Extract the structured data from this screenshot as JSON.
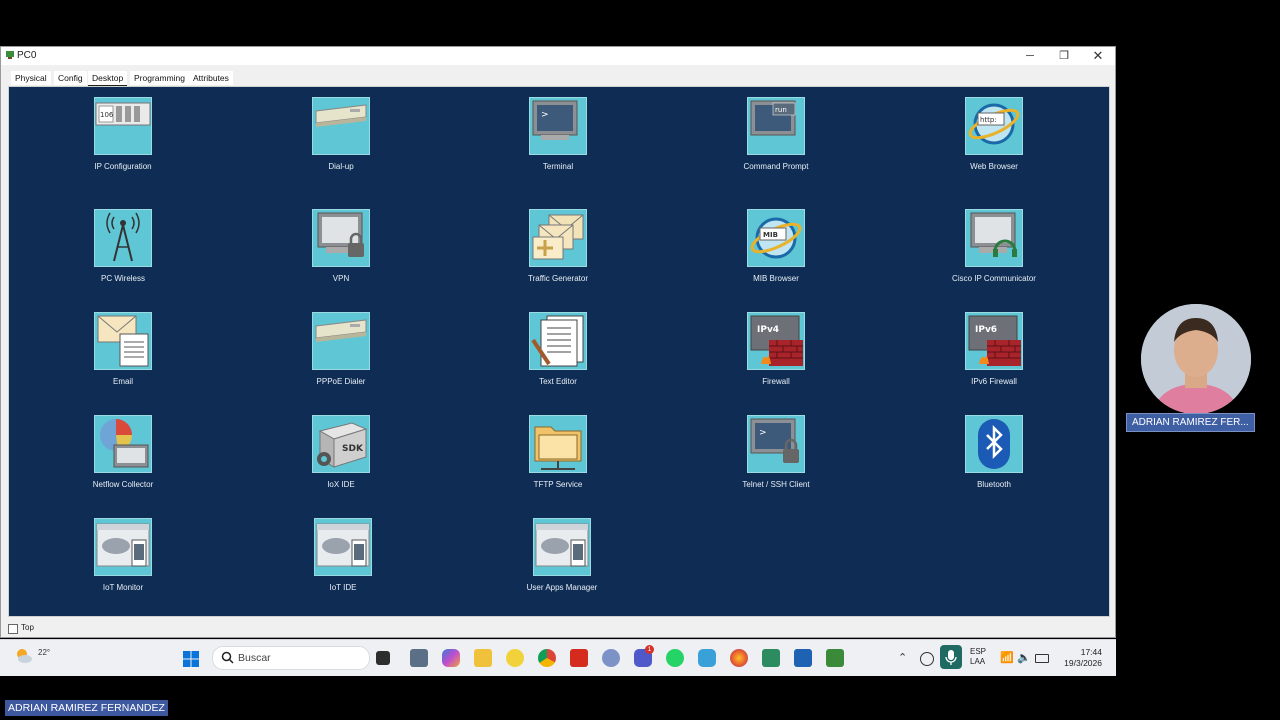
{
  "window": {
    "title": "PC0",
    "controls": {
      "minimize": "─",
      "maximize": "❐",
      "close": "✕"
    }
  },
  "tabs": [
    {
      "label": "Physical",
      "active": false
    },
    {
      "label": "Config",
      "active": false
    },
    {
      "label": "Desktop",
      "active": true
    },
    {
      "label": "Programming",
      "active": false
    },
    {
      "label": "Attributes",
      "active": false
    }
  ],
  "desktop": {
    "background": "#0f2d54",
    "tile_color": "#5ec6d4",
    "apps": [
      {
        "label": "IP Configuration",
        "icon": "ip-config-icon"
      },
      {
        "label": "Dial-up",
        "icon": "modem-icon"
      },
      {
        "label": "Terminal",
        "icon": "terminal-icon"
      },
      {
        "label": "Command Prompt",
        "icon": "command-prompt-icon"
      },
      {
        "label": "Web Browser",
        "icon": "web-browser-icon"
      },
      {
        "label": "PC Wireless",
        "icon": "wireless-tower-icon"
      },
      {
        "label": "VPN",
        "icon": "vpn-lock-icon"
      },
      {
        "label": "Traffic Generator",
        "icon": "envelopes-icon"
      },
      {
        "label": "MIB Browser",
        "icon": "mib-browser-icon"
      },
      {
        "label": "Cisco IP Communicator",
        "icon": "headset-monitor-icon"
      },
      {
        "label": "Email",
        "icon": "email-icon"
      },
      {
        "label": "PPPoE Dialer",
        "icon": "modem-icon"
      },
      {
        "label": "Text Editor",
        "icon": "text-editor-icon"
      },
      {
        "label": "Firewall",
        "icon": "ipv4-firewall-icon"
      },
      {
        "label": "IPv6 Firewall",
        "icon": "ipv6-firewall-icon"
      },
      {
        "label": "Netflow Collector",
        "icon": "pie-chart-icon"
      },
      {
        "label": "IoX IDE",
        "icon": "sdk-box-icon"
      },
      {
        "label": "TFTP Service",
        "icon": "folder-icon"
      },
      {
        "label": "Telnet / SSH Client",
        "icon": "terminal-lock-icon"
      },
      {
        "label": "Bluetooth",
        "icon": "bluetooth-icon"
      },
      {
        "label": "IoT Monitor",
        "icon": "cloud-phone-icon"
      },
      {
        "label": "IoT IDE",
        "icon": "cloud-phone-icon"
      },
      {
        "label": "User Apps Manager",
        "icon": "cloud-phone-icon"
      }
    ],
    "icon_texts": {
      "ip": "106",
      "cmd": "run",
      "web": "http:",
      "mib": "MIB",
      "v4": "IPv4",
      "v6": "IPv6",
      "sdk": "SDK"
    }
  },
  "bottom": {
    "top_checkbox_label": "Top",
    "top_checked": false
  },
  "taskbar": {
    "weather_temp": "22°",
    "search_placeholder": "Buscar",
    "lang_line1": "ESP",
    "lang_line2": "LAA",
    "time": "17:44",
    "date": "19/3/2026",
    "teams_badge": "1"
  },
  "webcam": {
    "name": "ADRIAN RAMIREZ FER..."
  },
  "footer": {
    "name": "ADRIAN RAMIREZ  FERNANDEZ"
  }
}
